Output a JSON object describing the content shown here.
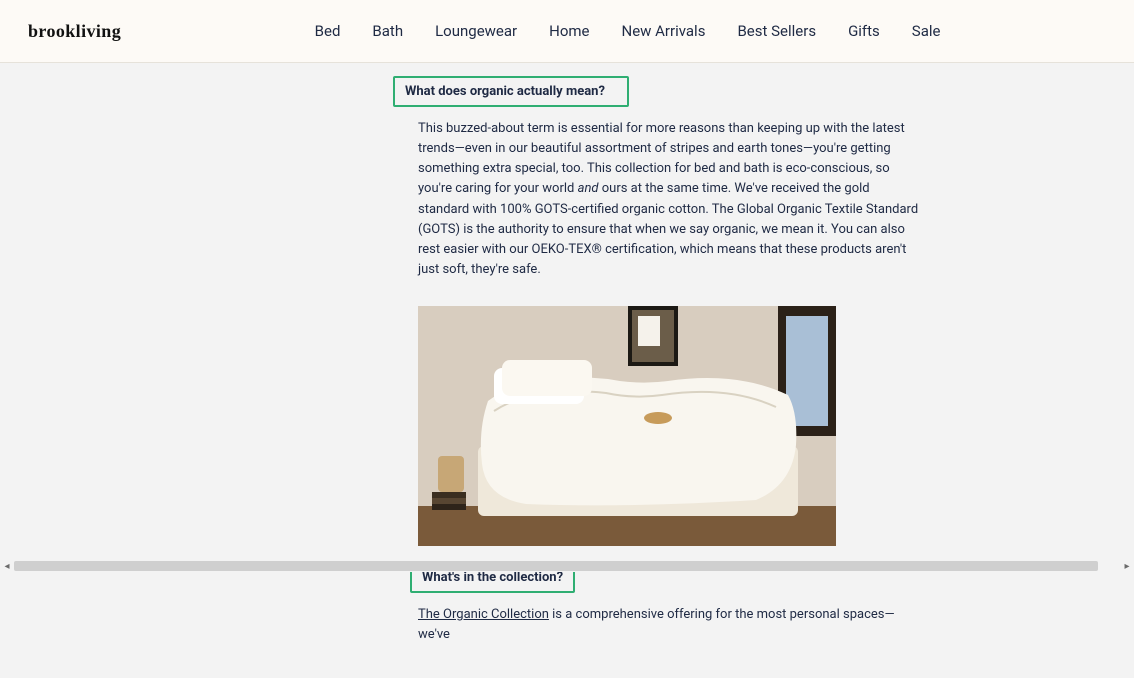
{
  "brand": "brookliving",
  "nav": [
    "Bed",
    "Bath",
    "Loungewear",
    "Home",
    "New Arrivals",
    "Best Sellers",
    "Gifts",
    "Sale"
  ],
  "section1": {
    "heading": "What does organic actually mean?",
    "para_before_em": "This buzzed-about term is essential for more reasons than keeping up with the latest trends—even in our beautiful assortment of stripes and earth tones—you're getting something extra special, too. This collection for bed and bath is eco-conscious, so you're caring for your world ",
    "em": "and",
    "para_after_em": " ours at the same time. We've received the gold standard with 100% GOTS-certified organic cotton. The Global Organic Textile Standard (GOTS) is the authority to ensure that when we say organic, we mean it. You can also rest easier with our OEKO-TEX® certification, which means that these products aren't just soft, they're safe."
  },
  "section2": {
    "heading": "What's in the collection?",
    "link_text": "The Organic Collection",
    "para_after_link": " is a comprehensive offering for the most personal spaces—we've"
  },
  "image_alt": "Bedroom scene with white bedding"
}
